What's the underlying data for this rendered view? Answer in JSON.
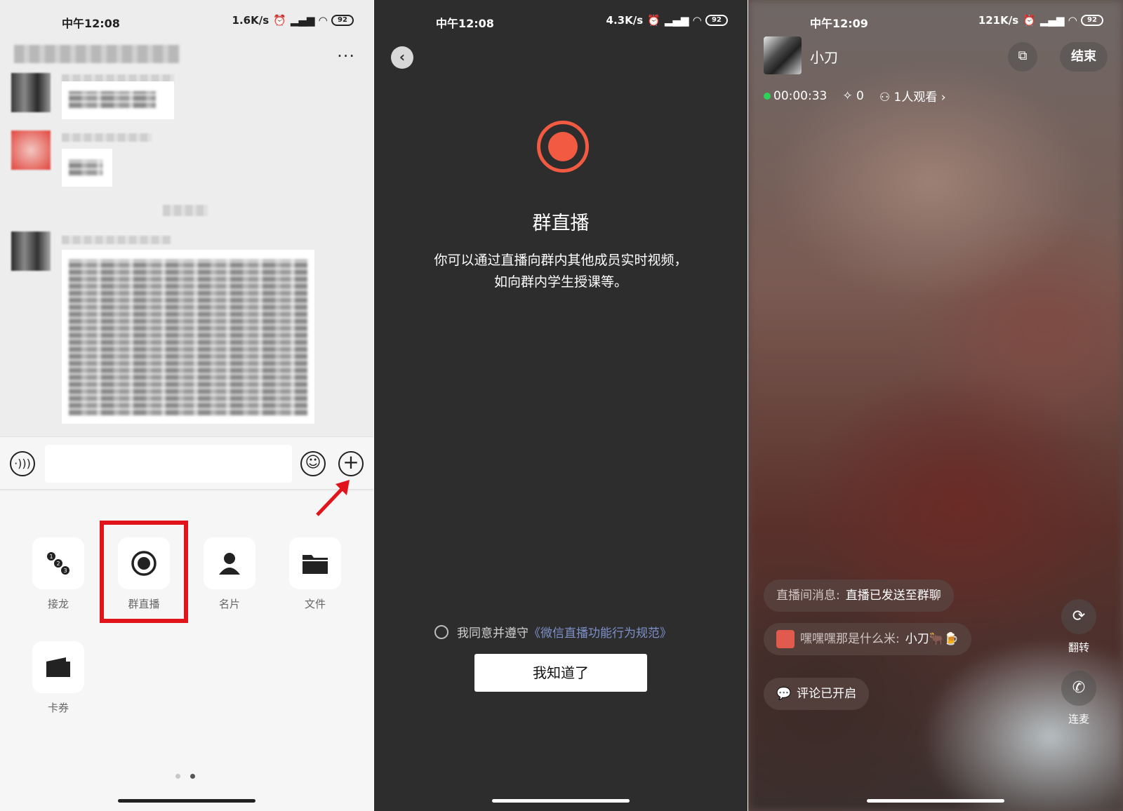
{
  "panel1": {
    "status": {
      "time": "中午12:08",
      "speed": "1.6K/s",
      "battery": "92"
    },
    "tools": [
      {
        "label": "接龙"
      },
      {
        "label": "群直播"
      },
      {
        "label": "名片"
      },
      {
        "label": "文件"
      },
      {
        "label": "卡券"
      }
    ],
    "highlight_color": "#e2141b"
  },
  "panel2": {
    "status": {
      "time": "中午12:08",
      "speed": "4.3K/s",
      "battery": "92"
    },
    "title": "群直播",
    "description_line1": "你可以通过直播向群内其他成员实时视频，",
    "description_line2": "如向群内学生授课等。",
    "agree_prefix": "我同意并遵守",
    "agree_link": "《微信直播功能行为规范》",
    "confirm_button": "我知道了",
    "accent_color": "#f25a41"
  },
  "panel3": {
    "status": {
      "time": "中午12:09",
      "speed": "121K/s",
      "battery": "92"
    },
    "host_name": "小刀",
    "end_button": "结束",
    "duration": "00:00:33",
    "likes": "0",
    "viewers": "1人观看",
    "system_msg_label": "直播间消息:",
    "system_msg_text": "直播已发送至群聊",
    "comment_user": "嘿嘿嘿那是什么米:",
    "comment_text": "小刀🐂🍺",
    "comments_status": "评论已开启",
    "flip_label": "翻转",
    "mic_label": "连麦"
  }
}
